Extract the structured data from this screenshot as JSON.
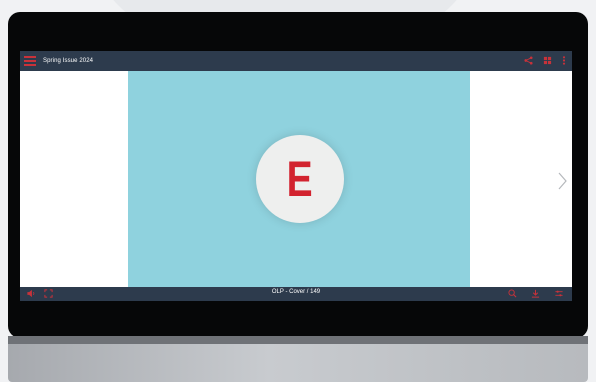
{
  "reader": {
    "title": "Spring Issue 2024",
    "page_indicator": "OLP - Cover / 149",
    "logo_letter": "E"
  },
  "icons": {
    "menu": "hamburger-menu-icon",
    "share": "share-icon",
    "thumbnails": "thumbnails-icon",
    "more": "more-vertical-icon",
    "sound": "speaker-icon",
    "fullscreen": "fullscreen-icon",
    "zoom": "zoom-icon",
    "download": "download-icon",
    "settings": "settings-icon",
    "next": "chevron-right-icon"
  },
  "colors": {
    "accent": "#c8323a",
    "bar": "#2d3b4d",
    "page_bg": "#8fd2de",
    "logo_red": "#d2232f"
  }
}
